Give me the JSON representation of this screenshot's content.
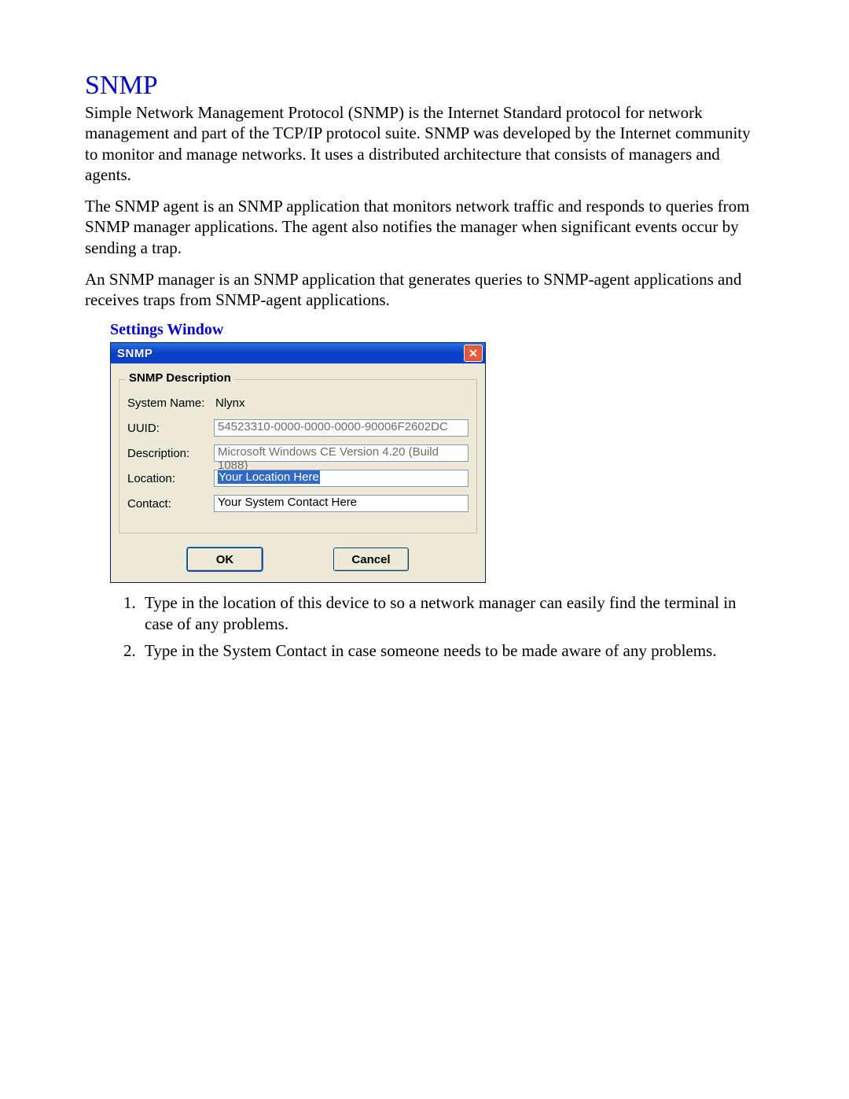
{
  "heading": "SNMP",
  "para1": "Simple Network Management Protocol (SNMP) is the Internet Standard protocol for network management and part of the TCP/IP protocol suite. SNMP was developed by the Internet community to monitor and manage networks. It uses a distributed architecture that consists of managers and agents.",
  "para2": "The SNMP agent is an SNMP application that monitors network traffic and responds to queries from SNMP manager applications.  The agent also notifies the manager when significant events occur by sending a trap.",
  "para3": "An SNMP manager is an SNMP application that generates queries to SNMP-agent applications and receives traps from SNMP-agent applications.",
  "subheading": "Settings Window",
  "dialog": {
    "title": "SNMP",
    "group_legend": "SNMP Description",
    "labels": {
      "system_name": "System Name:",
      "uuid": "UUID:",
      "description": "Description:",
      "location": "Location:",
      "contact": "Contact:"
    },
    "values": {
      "system_name": "Nlynx",
      "uuid": "54523310-0000-0000-0000-90006F2602DC",
      "description": "Microsoft Windows CE Version 4.20 (Build 1088)",
      "location": "Your Location Here",
      "contact": "Your System Contact Here"
    },
    "buttons": {
      "ok": "OK",
      "cancel": "Cancel"
    },
    "close_glyph": "✕"
  },
  "steps": {
    "s1": "Type in the location of this device to so a network manager can easily find the terminal in case of any problems.",
    "s2": "Type in the System Contact in case someone needs to be made aware of any problems."
  }
}
